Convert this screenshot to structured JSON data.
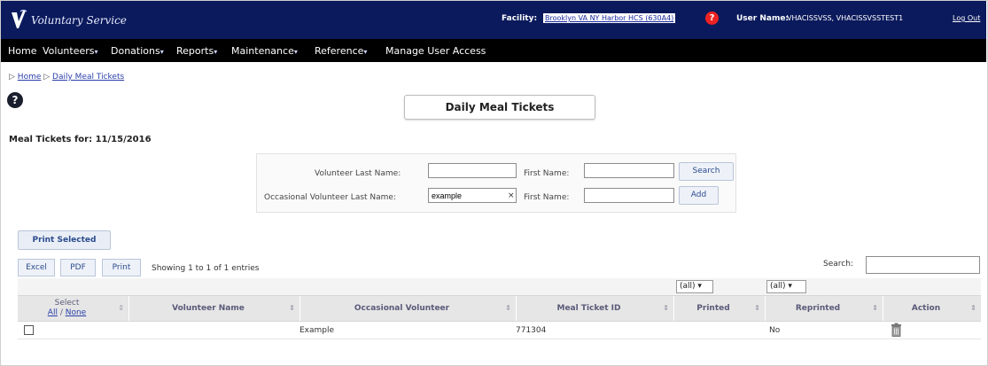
{
  "header": {
    "app_title": "Voluntary Service",
    "facility_label": "Facility:",
    "facility_value": "Brooklyn VA NY Harbor HCS (630A4)",
    "user_label": "User Name:",
    "user_value": "VHACISSVSS, VHACISSVSSTEST1",
    "logout": "Log Out"
  },
  "nav": {
    "items": [
      {
        "label": "Home",
        "dropdown": false
      },
      {
        "label": "Volunteers",
        "dropdown": true
      },
      {
        "label": "Donations",
        "dropdown": true
      },
      {
        "label": "Reports",
        "dropdown": true
      },
      {
        "label": "Maintenance",
        "dropdown": true
      },
      {
        "label": "Reference",
        "dropdown": true
      },
      {
        "label": "Manage User Access",
        "dropdown": false
      }
    ]
  },
  "breadcrumb": {
    "home": "Home",
    "current": "Daily Meal Tickets"
  },
  "page_title": "Daily Meal Tickets",
  "meal_tickets_for": "Meal Tickets for: 11/15/2016",
  "search_form": {
    "vol_last_name_label": "Volunteer Last Name:",
    "vol_last_name_value": "",
    "first_name_label": "First Name:",
    "first_name_value": "",
    "search_button": "Search",
    "occ_last_name_label": "Occasional Volunteer Last Name:",
    "occ_last_name_value": "example",
    "occ_first_name_label": "First Name:",
    "occ_first_name_value": "",
    "add_button": "Add"
  },
  "toolbar": {
    "print_selected": "Print Selected",
    "excel": "Excel",
    "pdf": "PDF",
    "print": "Print",
    "showing": "Showing 1 to 1 of 1 entries",
    "search_label": "Search:"
  },
  "filters": {
    "printed": "(all)",
    "reprinted": "(all)"
  },
  "table": {
    "columns": {
      "select_line1": "Select",
      "select_all": "All",
      "select_sep": " / ",
      "select_none": "None",
      "volunteer_name": "Volunteer Name",
      "occasional_volunteer": "Occasional Volunteer",
      "meal_ticket_id": "Meal Ticket ID",
      "printed": "Printed",
      "reprinted": "Reprinted",
      "action": "Action"
    },
    "rows": [
      {
        "volunteer_name": "",
        "occasional_volunteer": "Example",
        "meal_ticket_id": "771304",
        "printed": "",
        "reprinted": "No"
      }
    ]
  }
}
